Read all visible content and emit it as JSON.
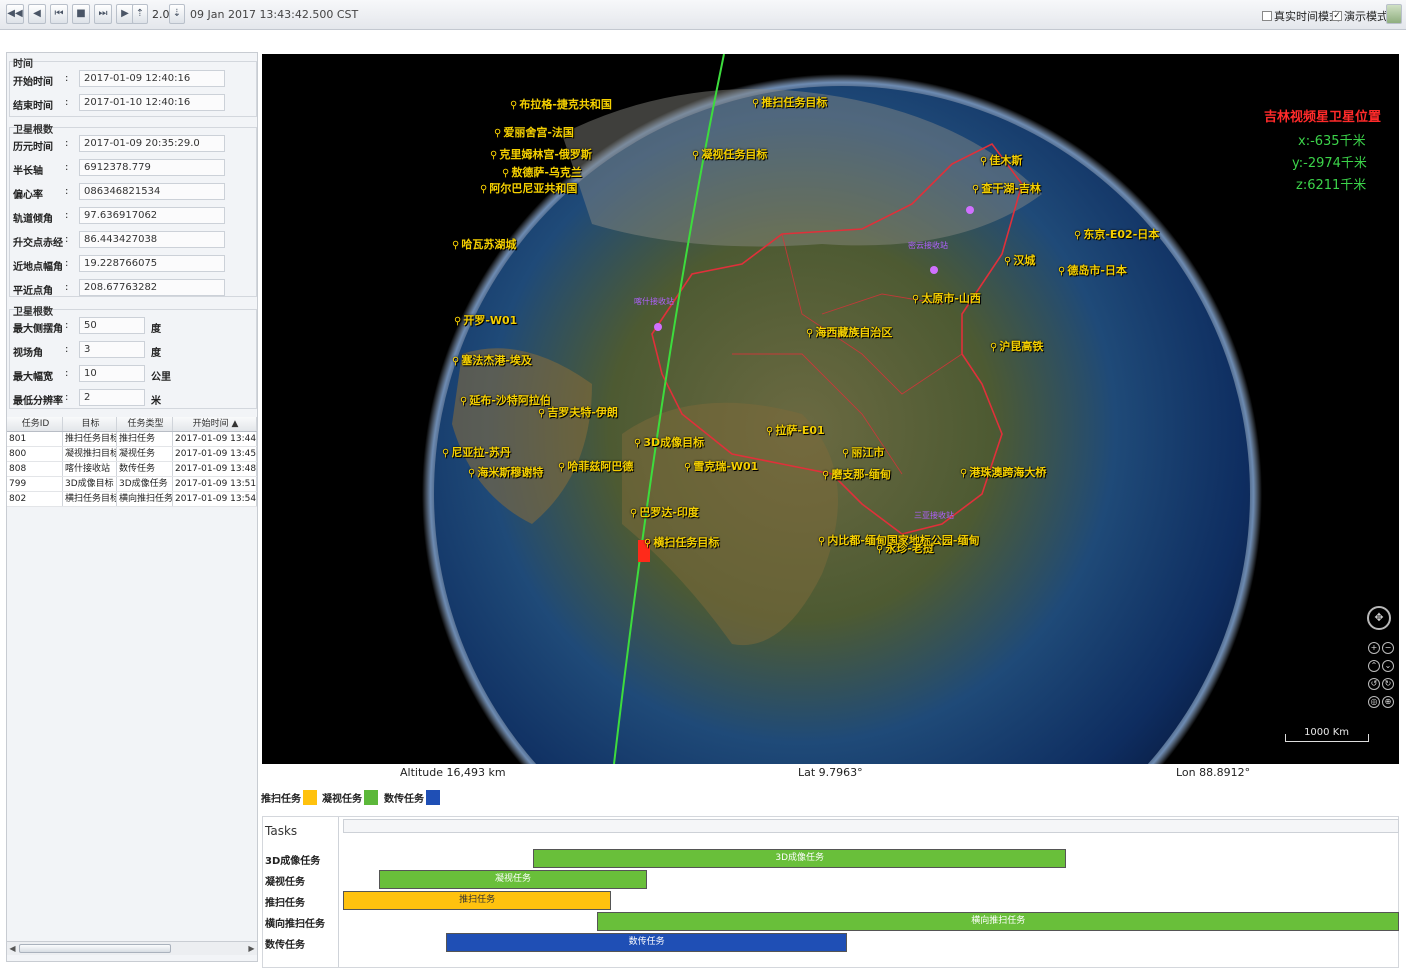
{
  "toolbar": {
    "speed": "2.0",
    "time": "09 Jan 2017 13:43:42.500 CST",
    "realtime_label": "真实时间模式",
    "demo_label": "演示模式",
    "demo_checked": "✓"
  },
  "time_group": {
    "title": "时间",
    "start_label": "开始时间",
    "start_value": "2017-01-09 12:40:16",
    "end_label": "结束时间",
    "end_value": "2017-01-10 12:40:16"
  },
  "orbit_group": {
    "title": "卫星根数",
    "fields": [
      {
        "label": "历元时间",
        "value": "2017-01-09 20:35:29.0"
      },
      {
        "label": "半长轴",
        "value": "6912378.779"
      },
      {
        "label": "偏心率",
        "value": "086346821534"
      },
      {
        "label": "轨道倾角",
        "value": "97.636917062"
      },
      {
        "label": "升交点赤经",
        "value": "86.443427038"
      },
      {
        "label": "近地点幅角",
        "value": "19.228766075"
      },
      {
        "label": "平近点角",
        "value": "208.67763282"
      }
    ]
  },
  "payload_group": {
    "title": "卫星根数",
    "fields": [
      {
        "label": "最大侧摆角",
        "value": "50",
        "unit": "度"
      },
      {
        "label": "视场角",
        "value": "3",
        "unit": "度"
      },
      {
        "label": "最大幅宽",
        "value": "10",
        "unit": "公里"
      },
      {
        "label": "最低分辨率",
        "value": "2",
        "unit": "米"
      }
    ]
  },
  "task_table": {
    "columns": [
      "任务ID",
      "目标",
      "任务类型",
      "开始时间"
    ],
    "rows": [
      [
        "801",
        "推扫任务目标",
        "推扫任务",
        "2017-01-09 13:44"
      ],
      [
        "800",
        "凝视推扫目标",
        "凝视任务",
        "2017-01-09 13:45"
      ],
      [
        "808",
        "喀什接收站",
        "数传任务",
        "2017-01-09 13:48"
      ],
      [
        "799",
        "3D成像目标",
        "3D成像任务",
        "2017-01-09 13:51"
      ],
      [
        "802",
        "横扫任务目标",
        "横向推扫任务",
        "2017-01-09 13:54"
      ]
    ]
  },
  "globe": {
    "places": [
      "布拉格-捷克共和国",
      "推扫任务目标",
      "爱丽舍宫-法国",
      "凝视任务目标",
      "克里姆林宫-俄罗斯",
      "敖德萨-乌克兰",
      "阿尔巴尼亚共和国",
      "佳木斯",
      "查干湖-吉林",
      "哈瓦苏湖城",
      "东京-E02-日本",
      "汉城",
      "德岛市-日本",
      "太原市-山西",
      "开罗-W01",
      "海西藏族自治区",
      "沪昆高铁",
      "塞法杰港-埃及",
      "延布-沙特阿拉伯",
      "吉罗夫特-伊朗",
      "拉萨-E01",
      "3D成像目标",
      "尼亚拉-苏丹",
      "丽江市",
      "海米斯穆谢特",
      "哈菲兹阿巴德",
      "雪克瑞-W01",
      "磨支那-缅甸",
      "港珠澳跨海大桥",
      "巴罗达-印度",
      "横扫任务目标",
      "内比都-缅甸国家地标公园-缅甸",
      "永珍-老挝"
    ],
    "stations": [
      "喀什接收站",
      "密云接收站",
      "三亚接收站"
    ],
    "sat_title": "吉林视频星卫星位置",
    "sat_x": "x:-635千米",
    "sat_y": "y:-2974千米",
    "sat_z": "z:6211千米",
    "scale_label": "1000 Km",
    "colors": {
      "label": "#f5d000",
      "orbit": "#3ddc3d",
      "border": "#e0303a",
      "station": "#b060ff"
    }
  },
  "status_bar": {
    "altitude": "Altitude  16,493 km",
    "lat": "Lat  9.7963°",
    "lon": "Lon 88.8912°"
  },
  "legend": [
    {
      "label": "推扫任务",
      "color": "#ffc20e"
    },
    {
      "label": "凝视任务",
      "color": "#5cb83a"
    },
    {
      "label": "数传任务",
      "color": "#1f4fb5"
    }
  ],
  "gantt": {
    "header": "Tasks",
    "rows": [
      {
        "label": "3D成像任务",
        "bar": "3D成像任务",
        "start": 0.18,
        "end": 0.685,
        "color": "#69bf3a"
      },
      {
        "label": "凝视任务",
        "bar": "凝视任务",
        "start": 0.034,
        "end": 0.288,
        "color": "#69bf3a"
      },
      {
        "label": "推扫任务",
        "bar": "推扫任务",
        "start": 0.0,
        "end": 0.254,
        "color": "#ffc20e"
      },
      {
        "label": "横向推扫任务",
        "bar": "横向推扫任务",
        "start": 0.241,
        "end": 1.0,
        "color": "#69bf3a"
      },
      {
        "label": "数传任务",
        "bar": "数传任务",
        "start": 0.098,
        "end": 0.477,
        "color": "#1f4fb5"
      }
    ]
  }
}
